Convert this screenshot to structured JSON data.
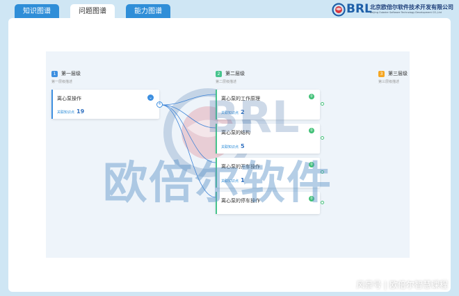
{
  "tabs": [
    {
      "label": "知识图谱"
    },
    {
      "label": "问题图谱"
    },
    {
      "label": "能力图谱"
    }
  ],
  "logo": {
    "letters": "BRL",
    "name_cn": "北京欧倍尔软件技术开发有限公司",
    "name_en": "Beijing Oubeier Software Technology Development CO.,Ltd"
  },
  "levels": [
    {
      "num": "1",
      "title": "第一层级",
      "desc": "第一层级描述",
      "color": "#3d8fe0"
    },
    {
      "num": "2",
      "title": "第二层级",
      "desc": "第二层级描述",
      "color": "#46c48d"
    },
    {
      "num": "3",
      "title": "第三层级",
      "desc": "第三层级描述",
      "color": "#f5a623"
    }
  ],
  "root_node": {
    "title": "离心泵操作",
    "meta_label": "关联知识点",
    "count": "19",
    "badge": "4"
  },
  "child_nodes": [
    {
      "title": "离心泵的工作原理",
      "meta_label": "关联知识点",
      "count": "2",
      "badge": "0"
    },
    {
      "title": "离心泵的结构",
      "meta_label": "关联知识点",
      "count": "5",
      "badge": "0"
    },
    {
      "title": "离心泵的开车操作",
      "meta_label": "关联知识点",
      "count": "1",
      "badge": "0"
    },
    {
      "title": "离心泵的停车操作",
      "meta_label": "",
      "count": "",
      "badge": "0"
    }
  ],
  "watermark": {
    "text": "欧倍尔软件",
    "brl": "BRL"
  },
  "footer": {
    "credit": "风景号 | 欧倍尔智慧课程"
  }
}
